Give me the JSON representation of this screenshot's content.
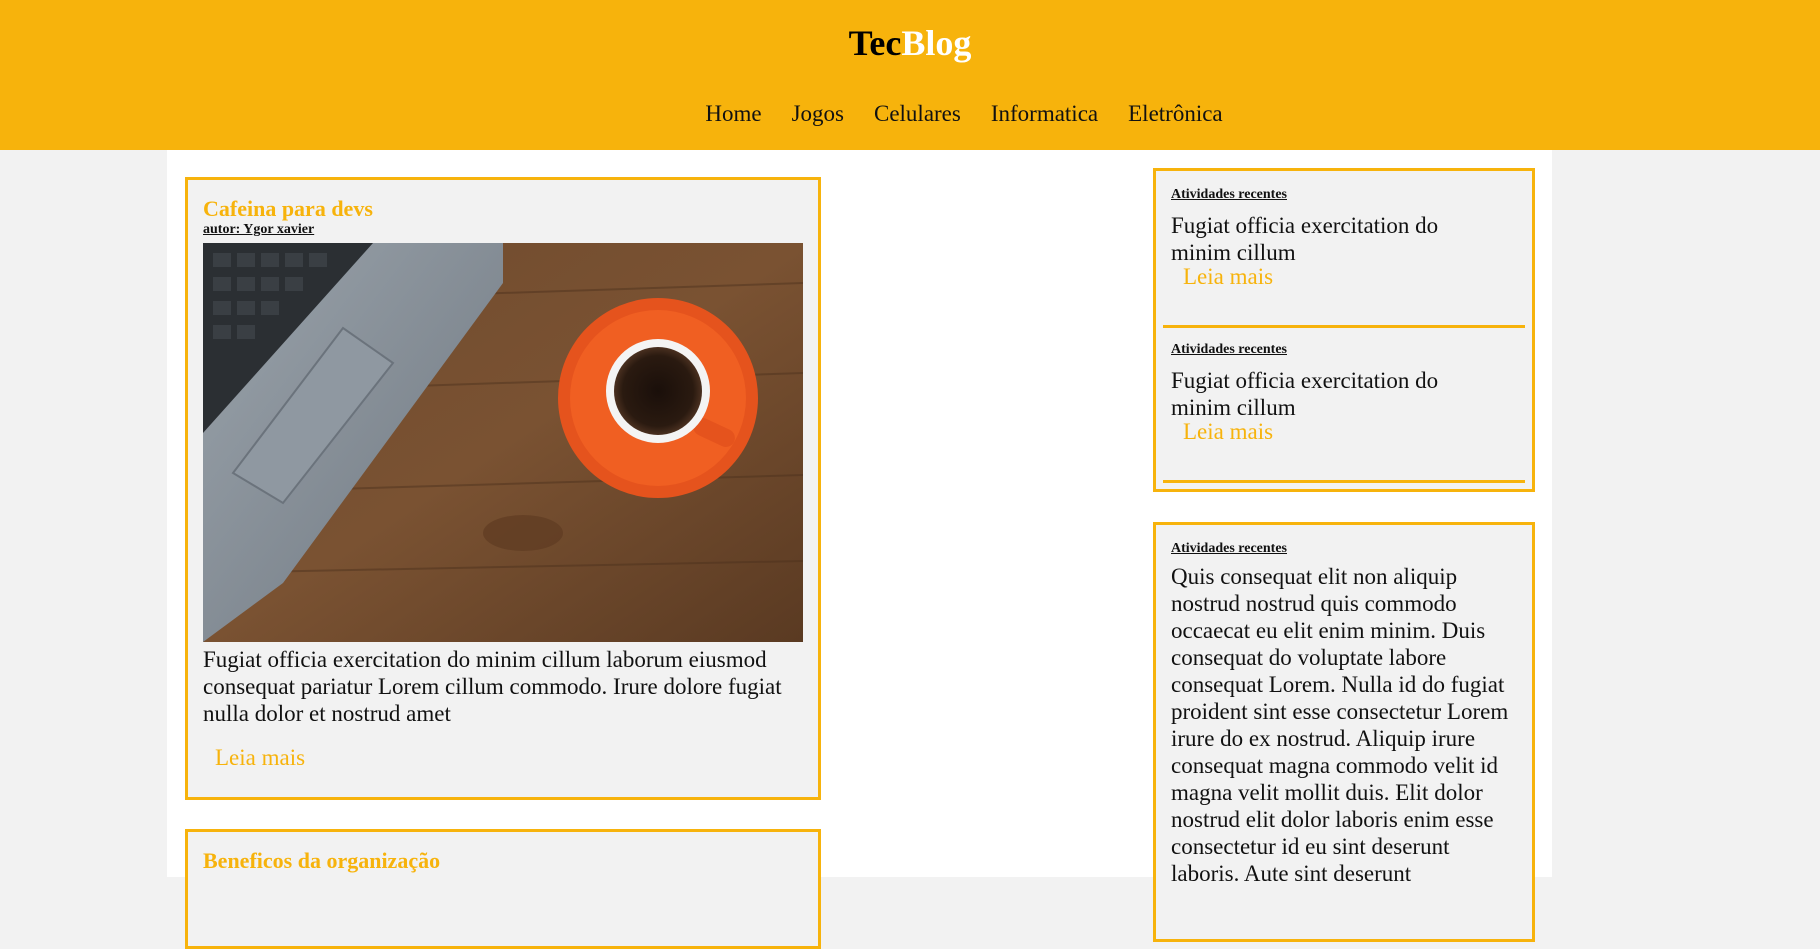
{
  "site": {
    "logo_part1": "Tec",
    "logo_part2": "Blog"
  },
  "nav": [
    "Home",
    "Jogos",
    "Celulares",
    "Informatica",
    "Eletrônica"
  ],
  "colors": {
    "accent": "#f7b30c",
    "page_bg": "#f2f2f2",
    "content_bg": "#ffffff"
  },
  "posts": [
    {
      "title": "Cafeina para devs",
      "author": "autor: Ygor xavier",
      "image": "laptop-and-coffee-cup-photo",
      "text": "Fugiat officia exercitation do minim cillum laborum eiusmod consequat pariatur Lorem cillum commodo. Irure dolore fugiat nulla dolor et nostrud amet",
      "read_more": "Leia mais"
    },
    {
      "title": "Beneficos da organização"
    }
  ],
  "sidebar": {
    "recent_1": {
      "title": "Atividades recentes",
      "text": "Fugiat officia exercitation do minim cillum",
      "read_more": "Leia mais"
    },
    "recent_2": {
      "title": "Atividades recentes",
      "text": "Fugiat officia exercitation do minim cillum",
      "read_more": "Leia mais"
    },
    "recent_3": {
      "title": "Atividades recentes",
      "text": "Quis consequat elit non aliquip nostrud nostrud quis commodo occaecat eu elit enim minim. Duis consequat do voluptate labore consequat Lorem. Nulla id do fugiat proident sint esse consectetur Lorem irure do ex nostrud. Aliquip irure consequat magna commodo velit id magna velit mollit duis. Elit dolor nostrud elit dolor laboris enim esse consectetur id eu sint deserunt laboris. Aute sint deserunt"
    }
  }
}
